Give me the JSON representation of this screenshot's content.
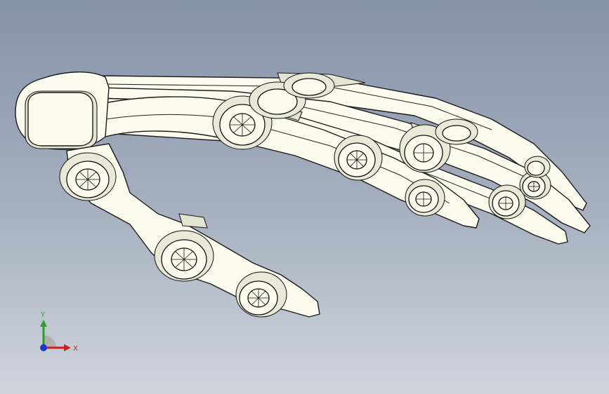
{
  "viewport": {
    "background_top": "#8593a8",
    "background_bottom": "#cfd5dd",
    "model_fill": "#fbfbee",
    "model_edge": "#1b1b1b"
  },
  "triad": {
    "y_label": "Y",
    "x_label": "X",
    "y_color": "#2e9e2e",
    "x_color": "#d21c1c",
    "z_color": "#1f36c8",
    "icon": "coordinate-triad-icon"
  }
}
